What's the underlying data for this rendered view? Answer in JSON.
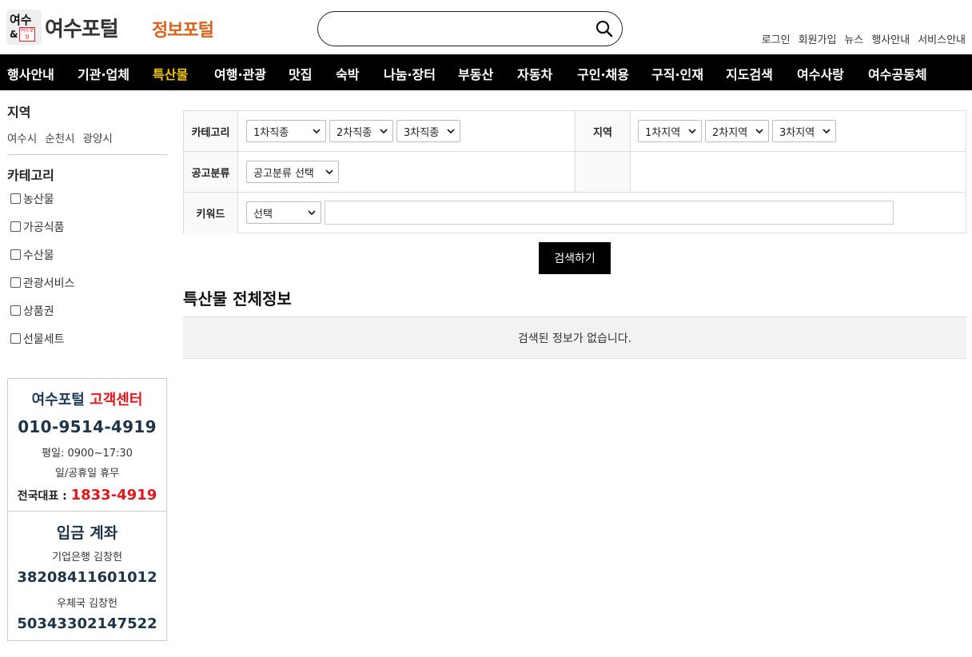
{
  "header": {
    "logo_badge_top": "여수",
    "logo_badge_amp": "&",
    "logo_badge_mini": "여수포털",
    "logo_text": "여수포털",
    "portal_text": "정보포털",
    "search_placeholder": "",
    "util_links": [
      "로그인",
      "회원가입",
      "뉴스",
      "행사안내",
      "서비스안내"
    ]
  },
  "nav": {
    "items": [
      "행사안내",
      "기관·업체",
      "특산물",
      "여행·관광",
      "맛집",
      "숙박",
      "나눔·장터",
      "부동산",
      "자동차",
      "구인·채용",
      "구직·인재",
      "지도검색",
      "여수사랑",
      "여수공동체"
    ],
    "active": "특산물",
    "active_color": "#f6c800"
  },
  "sidebar": {
    "region_title": "지역",
    "regions": [
      "여수시",
      "순천시",
      "광양시"
    ],
    "category_title": "카테고리",
    "categories": [
      "농산물",
      "가공식품",
      "수산물",
      "관광서비스",
      "상품권",
      "선물세트"
    ]
  },
  "customer_center": {
    "title_main": "여수포털",
    "title_red": "고객센터",
    "phone": "010-9514-4919",
    "hours": "평일: 0900~17:30",
    "off": "일/공휴일 휴무",
    "national_label": "전국대표 : ",
    "national_number": "1833-4919",
    "account_title": "입금 계좌",
    "account1_bank": "기업은행 김창헌",
    "account1_number": "38208411601012",
    "account2_bank": "우체국 김창헌",
    "account2_number": "50343302147522"
  },
  "filter": {
    "category_label": "카테고리",
    "category_selects": [
      "1차직종",
      "2차직종",
      "3차직종"
    ],
    "region_label": "지역",
    "region_selects": [
      "1차지역",
      "2차지역",
      "3차지역"
    ],
    "notice_label": "공고분류",
    "notice_select": "공고분류 선택",
    "keyword_label": "키워드",
    "keyword_select": "선택",
    "keyword_value": "",
    "search_button": "검색하기"
  },
  "results": {
    "section_title": "특산물 전체정보",
    "empty_message": "검색된 정보가 없습니다."
  }
}
